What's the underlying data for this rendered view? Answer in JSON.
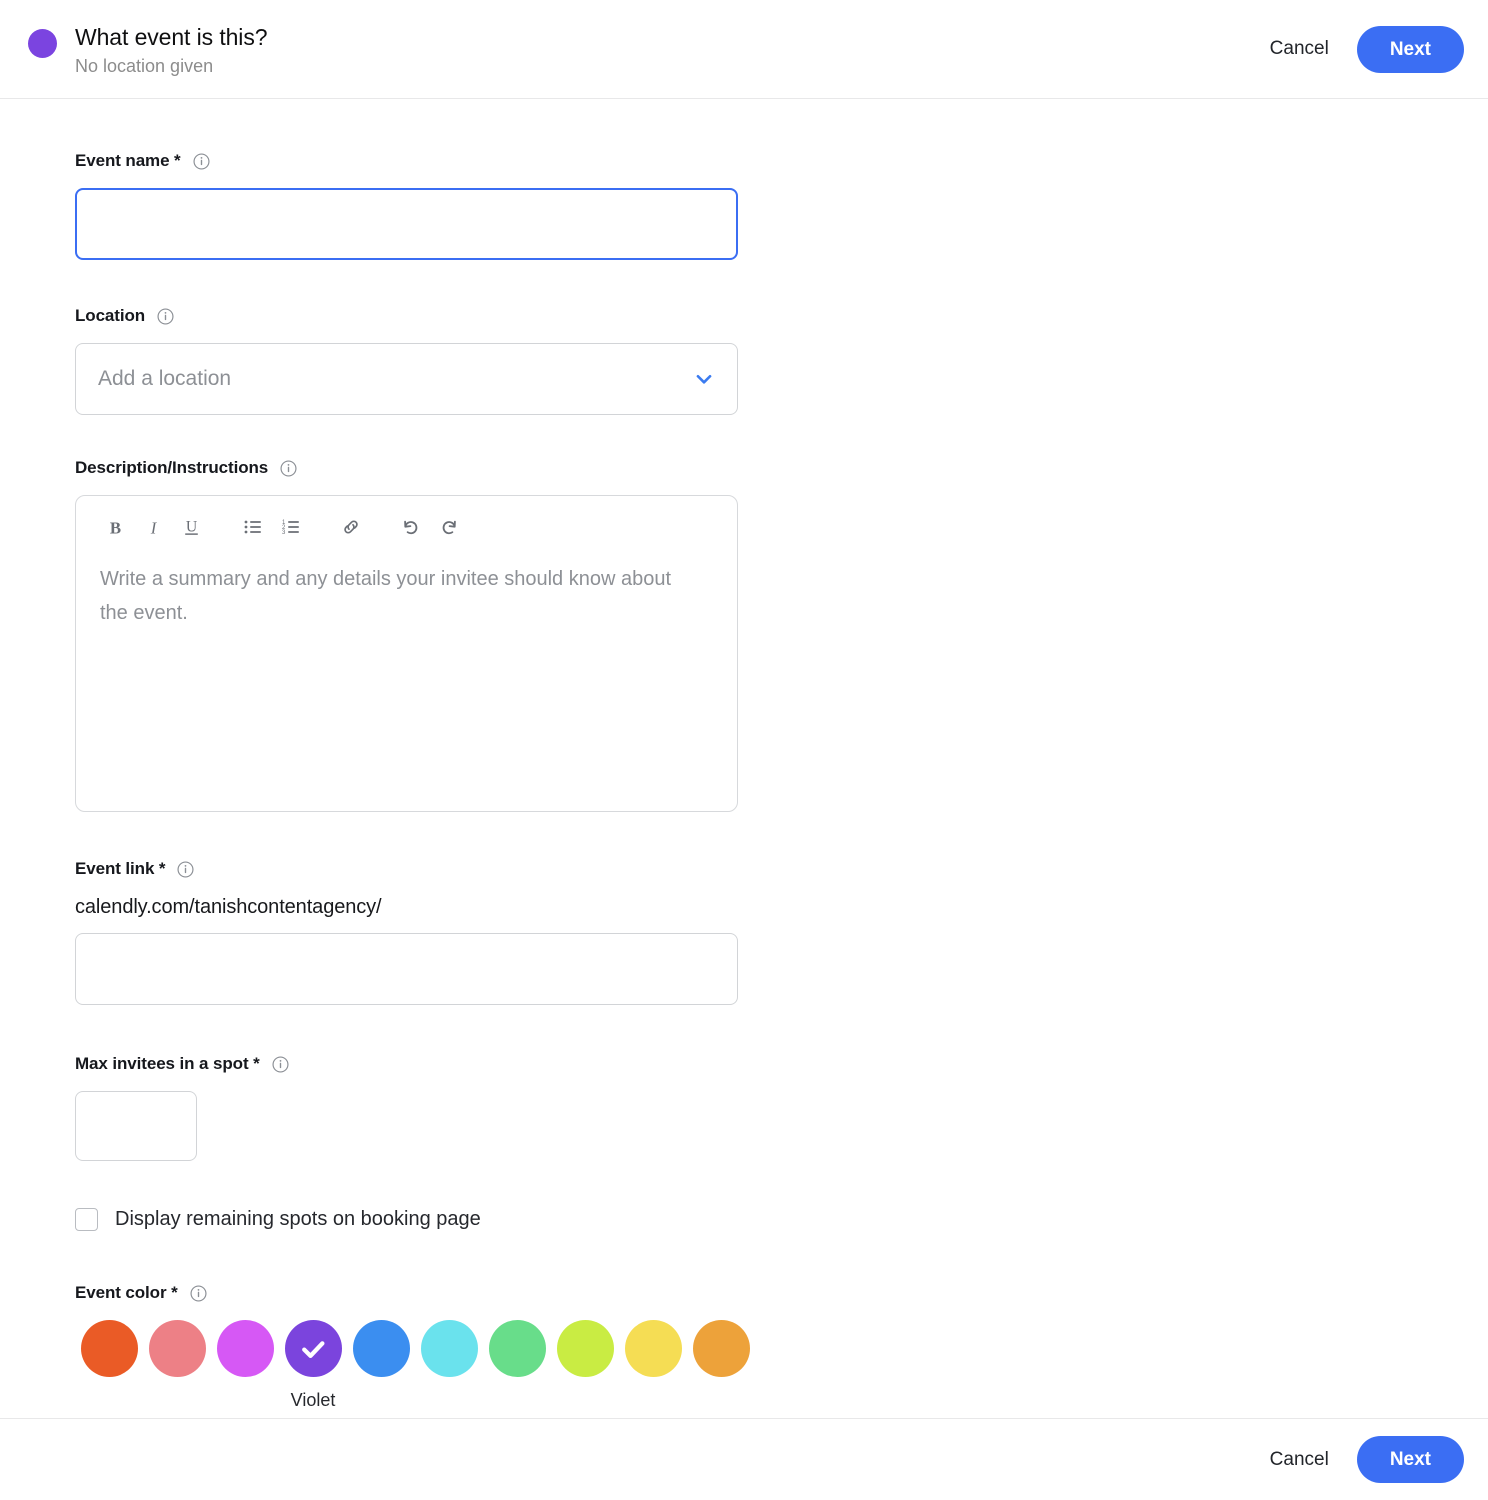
{
  "header": {
    "title": "What event is this?",
    "subtitle": "No location given",
    "dot_color": "#7b44e0",
    "cancel_label": "Cancel",
    "next_label": "Next"
  },
  "form": {
    "event_name": {
      "label": "Event name *",
      "value": "",
      "placeholder": "",
      "focused": true
    },
    "location": {
      "label": "Location",
      "value": "",
      "placeholder": "Add a location",
      "chevron_color": "#3b7bf0"
    },
    "description": {
      "label": "Description/Instructions",
      "placeholder": "Write a summary and any details your invitee should know about the event.",
      "value": "",
      "toolbar": [
        {
          "name": "bold-icon",
          "label": "B"
        },
        {
          "name": "italic-icon",
          "label": "I"
        },
        {
          "name": "underline-icon",
          "label": "U"
        },
        {
          "name": "bulleted-list-icon",
          "label": ""
        },
        {
          "name": "numbered-list-icon",
          "label": ""
        },
        {
          "name": "link-icon",
          "label": ""
        },
        {
          "name": "undo-icon",
          "label": ""
        },
        {
          "name": "redo-icon",
          "label": ""
        }
      ]
    },
    "event_link": {
      "label": "Event link *",
      "prefix": "calendly.com/tanishcontentagency/",
      "value": "",
      "placeholder": ""
    },
    "max_invitees": {
      "label": "Max invitees in a spot *",
      "value": "",
      "placeholder": "",
      "checkbox_label": "Display remaining spots on booking page",
      "checkbox_checked": false
    },
    "event_color": {
      "label": "Event color *",
      "selected_index": 3,
      "selected_name": "Violet",
      "swatches": [
        {
          "name": "Tomato",
          "hex": "#ea5b26"
        },
        {
          "name": "Flamingo",
          "hex": "#ed8086"
        },
        {
          "name": "Orchid",
          "hex": "#d658f5"
        },
        {
          "name": "Violet",
          "hex": "#7b44dd"
        },
        {
          "name": "Blueberry",
          "hex": "#3b8ef0"
        },
        {
          "name": "Turquoise",
          "hex": "#6ae2ed"
        },
        {
          "name": "Emerald",
          "hex": "#68dd8a"
        },
        {
          "name": "Lime",
          "hex": "#c9ec43"
        },
        {
          "name": "Banana",
          "hex": "#f5dd54"
        },
        {
          "name": "Tangerine",
          "hex": "#eda23a"
        }
      ]
    }
  },
  "footer": {
    "cancel_label": "Cancel",
    "next_label": "Next"
  }
}
